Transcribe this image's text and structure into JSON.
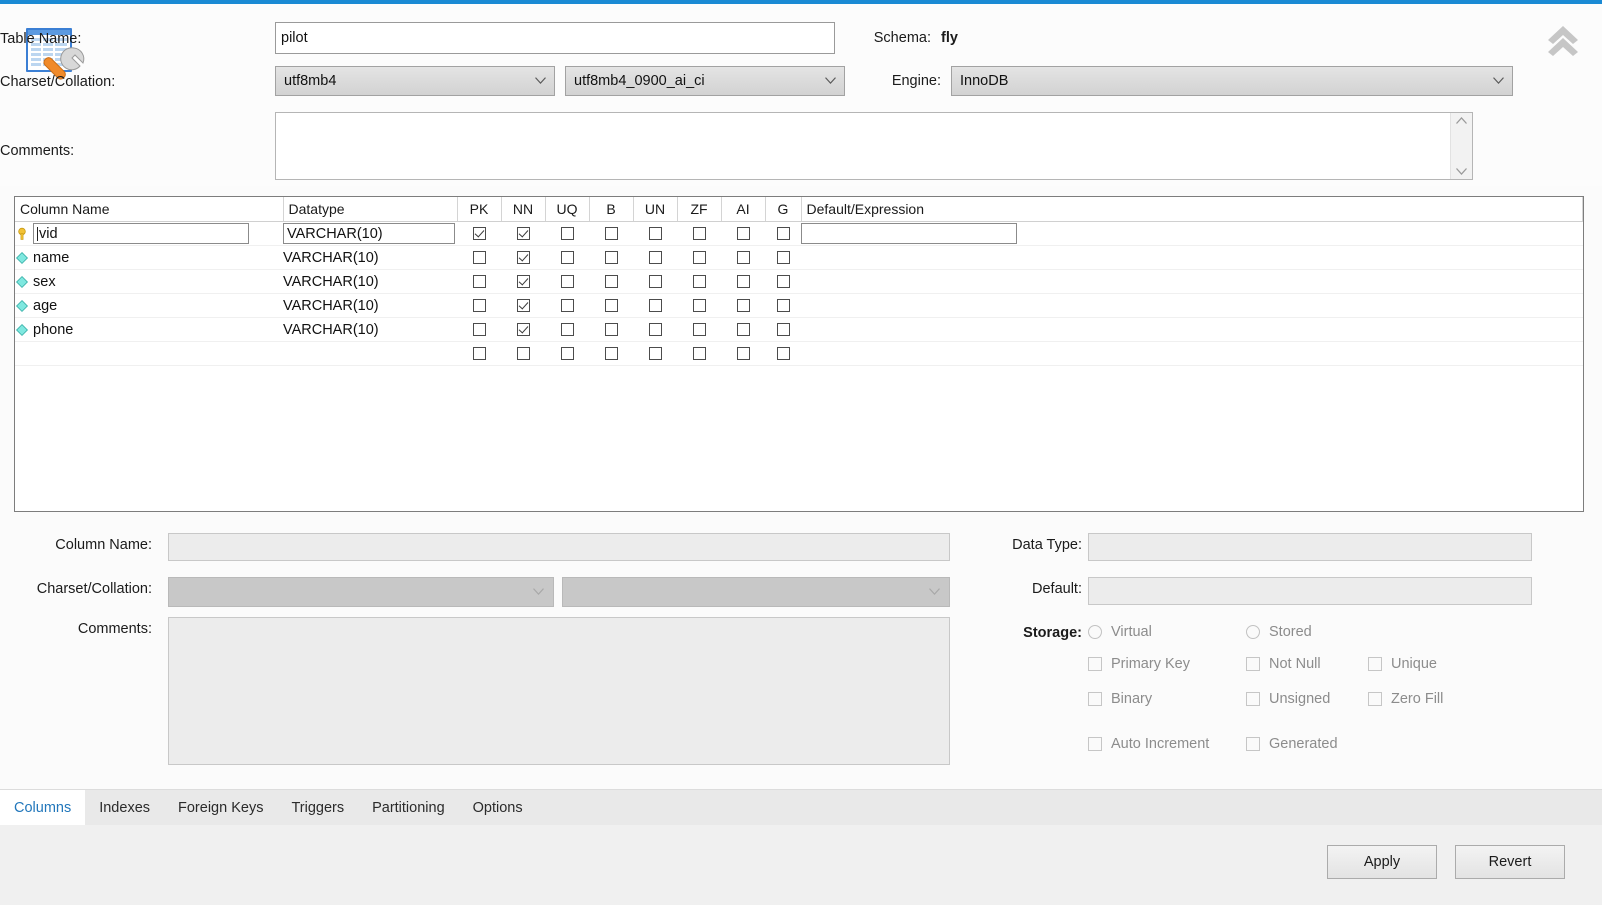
{
  "window": {
    "accent_color": "#1a8ad4",
    "table_icon": "table-wrench-icon",
    "collapse_icon": "double-chevron-up-icon"
  },
  "table_form": {
    "table_name_label": "Table Name:",
    "table_name_value": "pilot",
    "schema_label": "Schema:",
    "schema_value": "fly",
    "charset_label": "Charset/Collation:",
    "charset_value": "utf8mb4",
    "collation_value": "utf8mb4_0900_ai_ci",
    "engine_label": "Engine:",
    "engine_value": "InnoDB",
    "comments_label": "Comments:",
    "comments_value": ""
  },
  "grid": {
    "headers": {
      "column_name": "Column Name",
      "datatype": "Datatype",
      "pk": "PK",
      "nn": "NN",
      "uq": "UQ",
      "b": "B",
      "un": "UN",
      "zf": "ZF",
      "ai": "AI",
      "g": "G",
      "default_expression": "Default/Expression"
    },
    "rows": [
      {
        "icon": "primary-key-icon",
        "name": "vid",
        "datatype": "VARCHAR(10)",
        "pk": true,
        "nn": true,
        "uq": false,
        "b": false,
        "un": false,
        "zf": false,
        "ai": false,
        "g": false,
        "default": "",
        "editing": true
      },
      {
        "icon": "column-diamond-icon",
        "name": "name",
        "datatype": "VARCHAR(10)",
        "pk": false,
        "nn": true,
        "uq": false,
        "b": false,
        "un": false,
        "zf": false,
        "ai": false,
        "g": false,
        "default": "",
        "editing": false
      },
      {
        "icon": "column-diamond-icon",
        "name": "sex",
        "datatype": "VARCHAR(10)",
        "pk": false,
        "nn": true,
        "uq": false,
        "b": false,
        "un": false,
        "zf": false,
        "ai": false,
        "g": false,
        "default": "",
        "editing": false
      },
      {
        "icon": "column-diamond-icon",
        "name": "age",
        "datatype": "VARCHAR(10)",
        "pk": false,
        "nn": true,
        "uq": false,
        "b": false,
        "un": false,
        "zf": false,
        "ai": false,
        "g": false,
        "default": "",
        "editing": false
      },
      {
        "icon": "column-diamond-icon",
        "name": "phone",
        "datatype": "VARCHAR(10)",
        "pk": false,
        "nn": true,
        "uq": false,
        "b": false,
        "un": false,
        "zf": false,
        "ai": false,
        "g": false,
        "default": "",
        "editing": false
      },
      {
        "icon": "",
        "name": "",
        "datatype": "",
        "pk": false,
        "nn": false,
        "uq": false,
        "b": false,
        "un": false,
        "zf": false,
        "ai": false,
        "g": false,
        "default": "",
        "editing": false
      }
    ]
  },
  "detail": {
    "column_name_label": "Column Name:",
    "column_name_value": "",
    "charset_label": "Charset/Collation:",
    "charset_value": "",
    "collation_value": "",
    "comments_label": "Comments:",
    "comments_value": "",
    "data_type_label": "Data Type:",
    "data_type_value": "",
    "default_label": "Default:",
    "default_value": "",
    "storage_label": "Storage:",
    "storage_options": [
      {
        "label": "Virtual",
        "type": "radio",
        "checked": false
      },
      {
        "label": "Stored",
        "type": "radio",
        "checked": false
      }
    ],
    "flags": [
      {
        "label": "Primary Key",
        "checked": false
      },
      {
        "label": "Not Null",
        "checked": false
      },
      {
        "label": "Unique",
        "checked": false
      },
      {
        "label": "Binary",
        "checked": false
      },
      {
        "label": "Unsigned",
        "checked": false
      },
      {
        "label": "Zero Fill",
        "checked": false
      },
      {
        "label": "Auto Increment",
        "checked": false
      },
      {
        "label": "Generated",
        "checked": false
      }
    ]
  },
  "tabs": [
    {
      "label": "Columns",
      "active": true
    },
    {
      "label": "Indexes",
      "active": false
    },
    {
      "label": "Foreign Keys",
      "active": false
    },
    {
      "label": "Triggers",
      "active": false
    },
    {
      "label": "Partitioning",
      "active": false
    },
    {
      "label": "Options",
      "active": false
    }
  ],
  "footer": {
    "apply_label": "Apply",
    "revert_label": "Revert"
  }
}
